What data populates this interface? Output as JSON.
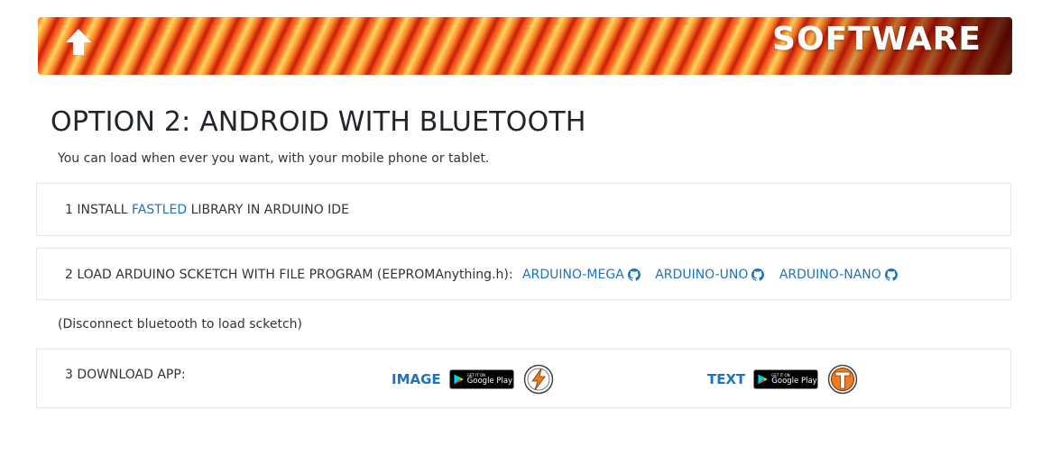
{
  "banner": {
    "title": "SOFTWARE",
    "back_icon": "arrow-up-icon"
  },
  "page": {
    "title": "OPTION 2: ANDROID WITH BLUETOOTH",
    "subtitle": "You can load when ever you want, with your mobile phone or tablet."
  },
  "steps": {
    "step1": {
      "prefix": "1 INSTALL ",
      "link": "FASTLED",
      "suffix": " LIBRARY IN ARDUINO IDE"
    },
    "step2": {
      "text": "2 LOAD ARDUINO SCKETCH WITH FILE PROGRAM (EEPROMAnything.h):",
      "links": [
        "ARDUINO-MEGA",
        "ARDUINO-UNO",
        "ARDUINO-NANO"
      ],
      "link_icon": "github-icon"
    },
    "note": "(Disconnect bluetooth to load scketch)",
    "step3": {
      "text": "3 DOWNLOAD APP:",
      "apps": [
        {
          "label": "IMAGE",
          "store_small": "GET IT ON",
          "store_big": "Google Play",
          "logo_icon": "lightning-logo-icon"
        },
        {
          "label": "TEXT",
          "store_small": "GET IT ON",
          "store_big": "Google Play",
          "logo_icon": "t-logo-icon"
        }
      ]
    }
  },
  "colors": {
    "link": "#1e73be",
    "banner_orange": "#ff5a1a",
    "logo_orange": "#f47a20"
  }
}
